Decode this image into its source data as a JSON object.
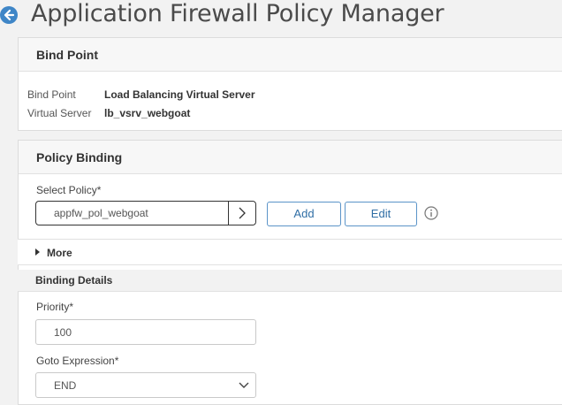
{
  "page": {
    "title": "Application Firewall Policy Manager"
  },
  "icons": {
    "back": "arrow-left-circle-icon",
    "chevron": "chevron-right-icon",
    "info": "info-circle-icon",
    "dropdown": "chevron-down-icon",
    "expand": "triangle-right-icon"
  },
  "colors": {
    "accent": "#3f86c7",
    "button_border": "#5b94c8",
    "button_text": "#2f6ea5"
  },
  "bind_point": {
    "heading": "Bind Point",
    "rows": [
      {
        "label": "Bind Point",
        "value": "Load Balancing Virtual Server"
      },
      {
        "label": "Virtual Server",
        "value": "lb_vsrv_webgoat"
      }
    ]
  },
  "policy_binding": {
    "heading": "Policy Binding",
    "select_policy_label": "Select Policy*",
    "select_policy_value": "appfw_pol_webgoat",
    "add_label": "Add",
    "edit_label": "Edit",
    "more_label": "More"
  },
  "binding_details": {
    "heading": "Binding Details",
    "priority_label": "Priority*",
    "priority_value": "100",
    "goto_label": "Goto Expression*",
    "goto_value": "END"
  }
}
